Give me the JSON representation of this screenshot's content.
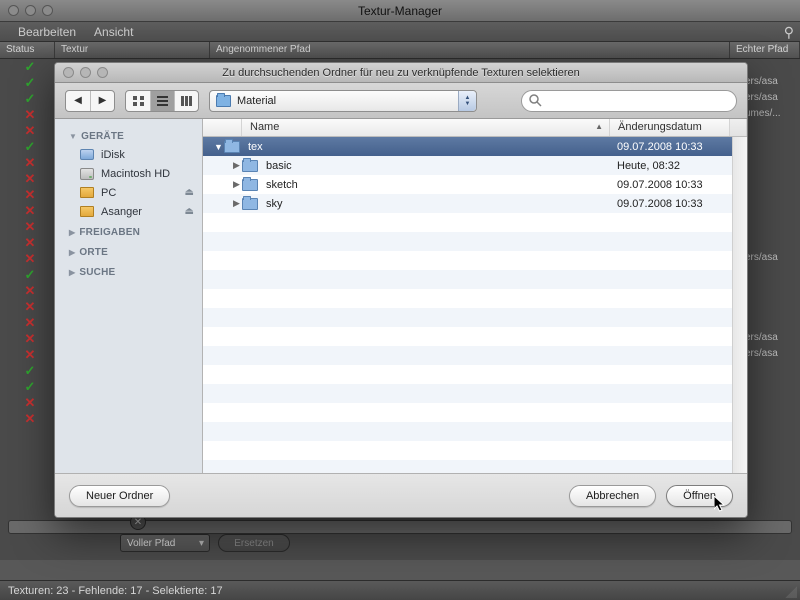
{
  "bg": {
    "title": "Textur-Manager",
    "menu": {
      "edit": "Bearbeiten",
      "view": "Ansicht"
    },
    "columns": {
      "status": "Status",
      "texture": "Textur",
      "assumed": "Angenommener Pfad",
      "real": "Echter Pfad"
    },
    "status_marks": [
      "ok",
      "ok",
      "ok",
      "x",
      "x",
      "ok",
      "x",
      "x",
      "x",
      "x",
      "x",
      "x",
      "x",
      "ok",
      "x",
      "x",
      "x",
      "x",
      "x",
      "ok",
      "ok",
      "x",
      "x"
    ],
    "right_paths": [
      "",
      "ers/asa",
      "ers/asa",
      "umes/...",
      "",
      "",
      "",
      "",
      "",
      "",
      "",
      "",
      "ers/asa",
      "",
      "",
      "",
      "",
      "ers/asa",
      "ers/asa",
      "",
      "",
      "",
      ""
    ],
    "footer": {
      "path_mode": "Voller Pfad",
      "replace": "Ersetzen",
      "status": "Texturen: 23 - Fehlende: 17 - Selektierte: 17"
    }
  },
  "sheet": {
    "title": "Zu durchsuchenden Ordner für neu zu verknüpfende Texturen selektieren",
    "path_selected": "Material",
    "search_placeholder": "",
    "columns": {
      "name": "Name",
      "date": "Änderungsdatum"
    },
    "rows": [
      {
        "depth": 0,
        "expanded": true,
        "name": "tex",
        "date": "09.07.2008 10:33",
        "selected": true
      },
      {
        "depth": 1,
        "expanded": false,
        "name": "basic",
        "date": "Heute, 08:32",
        "selected": false
      },
      {
        "depth": 1,
        "expanded": false,
        "name": "sketch",
        "date": "09.07.2008 10:33",
        "selected": false
      },
      {
        "depth": 1,
        "expanded": false,
        "name": "sky",
        "date": "09.07.2008 10:33",
        "selected": false
      }
    ],
    "sidebar": {
      "devices_label": "GERÄTE",
      "devices": [
        {
          "name": "iDisk",
          "icon": "disk",
          "eject": false
        },
        {
          "name": "Macintosh HD",
          "icon": "hdd",
          "eject": false
        },
        {
          "name": "PC",
          "icon": "ext",
          "eject": true
        },
        {
          "name": "Asanger",
          "icon": "ext",
          "eject": true
        }
      ],
      "shares_label": "FREIGABEN",
      "places_label": "ORTE",
      "search_label": "SUCHE"
    },
    "buttons": {
      "new_folder": "Neuer Ordner",
      "cancel": "Abbrechen",
      "open": "Öffnen"
    }
  }
}
